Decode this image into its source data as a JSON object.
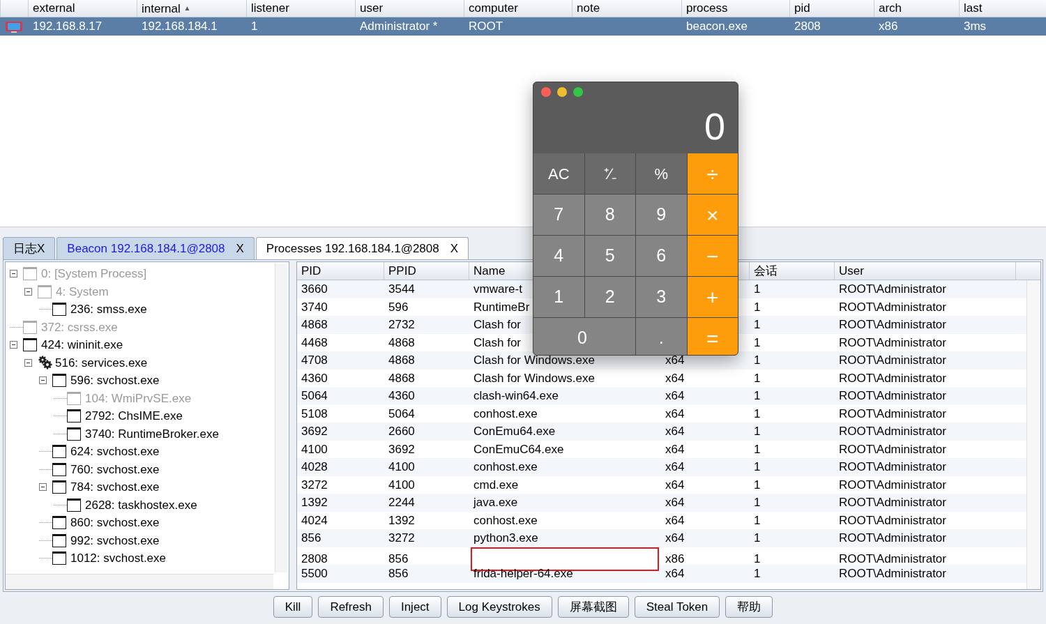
{
  "sessions": {
    "columns": [
      {
        "label": "external",
        "sorted": false
      },
      {
        "label": "internal",
        "sorted": true,
        "sort_mark": "▲"
      },
      {
        "label": "listener",
        "sorted": false
      },
      {
        "label": "user",
        "sorted": false
      },
      {
        "label": "computer",
        "sorted": false
      },
      {
        "label": "note",
        "sorted": false
      },
      {
        "label": "process",
        "sorted": false
      },
      {
        "label": "pid",
        "sorted": false
      },
      {
        "label": "arch",
        "sorted": false
      },
      {
        "label": "last",
        "sorted": false
      }
    ],
    "rows": [
      {
        "selected": true,
        "cells": [
          "192.168.8.17",
          "192.168.184.1",
          "1",
          "Administrator *",
          "ROOT",
          null,
          "beacon.exe",
          "2808",
          "x86",
          "3ms"
        ]
      }
    ]
  },
  "tabs": [
    {
      "label": "日志",
      "close": "X",
      "selected": false,
      "color": "#000000"
    },
    {
      "label": "Beacon 192.168.184.1@2808",
      "close": "X",
      "selected": false,
      "color": "#1a1ae6"
    },
    {
      "label": "Processes 192.168.184.1@2808",
      "close": "X",
      "selected": true,
      "color": "#000000"
    }
  ],
  "tree": [
    {
      "label": "0: [System Process]",
      "kind": "process",
      "dimmed": true,
      "expanded": true,
      "children": [
        {
          "label": "4: System",
          "kind": "process",
          "dimmed": true,
          "expanded": true,
          "children": [
            {
              "label": "236: smss.exe",
              "kind": "process",
              "dimmed": false
            }
          ]
        }
      ]
    },
    {
      "label": "372: csrss.exe",
      "kind": "process",
      "dimmed": true
    },
    {
      "label": "424: wininit.exe",
      "kind": "process",
      "dimmed": false,
      "expanded": true,
      "children": [
        {
          "label": "516: services.exe",
          "kind": "service",
          "dimmed": false,
          "expanded": true,
          "children": [
            {
              "label": "596: svchost.exe",
              "kind": "process",
              "dimmed": false,
              "expanded": true,
              "children": [
                {
                  "label": "104: WmiPrvSE.exe",
                  "kind": "process",
                  "dimmed": true
                },
                {
                  "label": "2792: ChsIME.exe",
                  "kind": "process",
                  "dimmed": false
                },
                {
                  "label": "3740: RuntimeBroker.exe",
                  "kind": "process",
                  "dimmed": false
                }
              ]
            },
            {
              "label": "624: svchost.exe",
              "kind": "process",
              "dimmed": false
            },
            {
              "label": "760: svchost.exe",
              "kind": "process",
              "dimmed": false
            },
            {
              "label": "784: svchost.exe",
              "kind": "process",
              "dimmed": false,
              "expanded": true,
              "children": [
                {
                  "label": "2628: taskhostex.exe",
                  "kind": "process",
                  "dimmed": false
                }
              ]
            },
            {
              "label": "860: svchost.exe",
              "kind": "process",
              "dimmed": false
            },
            {
              "label": "992: svchost.exe",
              "kind": "process",
              "dimmed": false
            },
            {
              "label": "1012: svchost.exe",
              "kind": "process",
              "dimmed": false
            }
          ]
        }
      ]
    }
  ],
  "processes": {
    "columns": [
      "PID",
      "PPID",
      "Name",
      null,
      "会话",
      "User"
    ],
    "rows": [
      {
        "editing": false,
        "cells": [
          "3660",
          "3544",
          "vmware-t",
          null,
          "1",
          "ROOT\\Administrator"
        ]
      },
      {
        "editing": false,
        "cells": [
          "3740",
          "596",
          "RuntimeBr",
          null,
          "1",
          "ROOT\\Administrator"
        ]
      },
      {
        "editing": false,
        "cells": [
          "4868",
          "2732",
          "Clash for",
          null,
          "1",
          "ROOT\\Administrator"
        ]
      },
      {
        "editing": false,
        "cells": [
          "4468",
          "4868",
          "Clash for",
          null,
          "1",
          "ROOT\\Administrator"
        ]
      },
      {
        "editing": false,
        "cells": [
          "4708",
          "4868",
          "Clash for Windows.exe",
          "x64",
          "1",
          "ROOT\\Administrator"
        ]
      },
      {
        "editing": false,
        "cells": [
          "4360",
          "4868",
          "Clash for Windows.exe",
          "x64",
          "1",
          "ROOT\\Administrator"
        ]
      },
      {
        "editing": false,
        "cells": [
          "5064",
          "4360",
          "clash-win64.exe",
          "x64",
          "1",
          "ROOT\\Administrator"
        ]
      },
      {
        "editing": false,
        "cells": [
          "5108",
          "5064",
          "conhost.exe",
          "x64",
          "1",
          "ROOT\\Administrator"
        ]
      },
      {
        "editing": false,
        "cells": [
          "3692",
          "2660",
          "ConEmu64.exe",
          "x64",
          "1",
          "ROOT\\Administrator"
        ]
      },
      {
        "editing": false,
        "cells": [
          "4100",
          "3692",
          "ConEmuC64.exe",
          "x64",
          "1",
          "ROOT\\Administrator"
        ]
      },
      {
        "editing": false,
        "cells": [
          "4028",
          "4100",
          "conhost.exe",
          "x64",
          "1",
          "ROOT\\Administrator"
        ]
      },
      {
        "editing": false,
        "cells": [
          "3272",
          "4100",
          "cmd.exe",
          "x64",
          "1",
          "ROOT\\Administrator"
        ]
      },
      {
        "editing": false,
        "cells": [
          "1392",
          "2244",
          "java.exe",
          "x64",
          "1",
          "ROOT\\Administrator"
        ]
      },
      {
        "editing": false,
        "cells": [
          "4024",
          "1392",
          "conhost.exe",
          "x64",
          "1",
          "ROOT\\Administrator"
        ]
      },
      {
        "editing": false,
        "cells": [
          "856",
          "3272",
          "python3.exe",
          "x64",
          "1",
          "ROOT\\Administrator"
        ]
      },
      {
        "editing": true,
        "cells": [
          "2808",
          "856",
          null,
          "x86",
          "1",
          "ROOT\\Administrator"
        ]
      },
      {
        "editing": false,
        "cells": [
          "5500",
          "856",
          "frida-helper-64.exe",
          "x64",
          "1",
          "ROOT\\Administrator"
        ]
      }
    ]
  },
  "buttons": [
    "Kill",
    "Refresh",
    "Inject",
    "Log Keystrokes",
    "屏幕截图",
    "Steal Token",
    "帮助"
  ],
  "calculator": {
    "display": "0",
    "keys": [
      {
        "label": "AC",
        "kind": "function"
      },
      {
        "label": "⁺∕₋",
        "kind": "function"
      },
      {
        "label": "%",
        "kind": "function"
      },
      {
        "label": "÷",
        "kind": "operator"
      },
      {
        "label": "7",
        "kind": "digit"
      },
      {
        "label": "8",
        "kind": "digit"
      },
      {
        "label": "9",
        "kind": "digit"
      },
      {
        "label": "×",
        "kind": "operator"
      },
      {
        "label": "4",
        "kind": "digit"
      },
      {
        "label": "5",
        "kind": "digit"
      },
      {
        "label": "6",
        "kind": "digit"
      },
      {
        "label": "−",
        "kind": "operator"
      },
      {
        "label": "1",
        "kind": "digit"
      },
      {
        "label": "2",
        "kind": "digit"
      },
      {
        "label": "3",
        "kind": "digit"
      },
      {
        "label": "+",
        "kind": "operator"
      },
      {
        "label": "0",
        "kind": "wide"
      },
      {
        "label": ".",
        "kind": "digit"
      },
      {
        "label": "=",
        "kind": "operator"
      }
    ]
  }
}
